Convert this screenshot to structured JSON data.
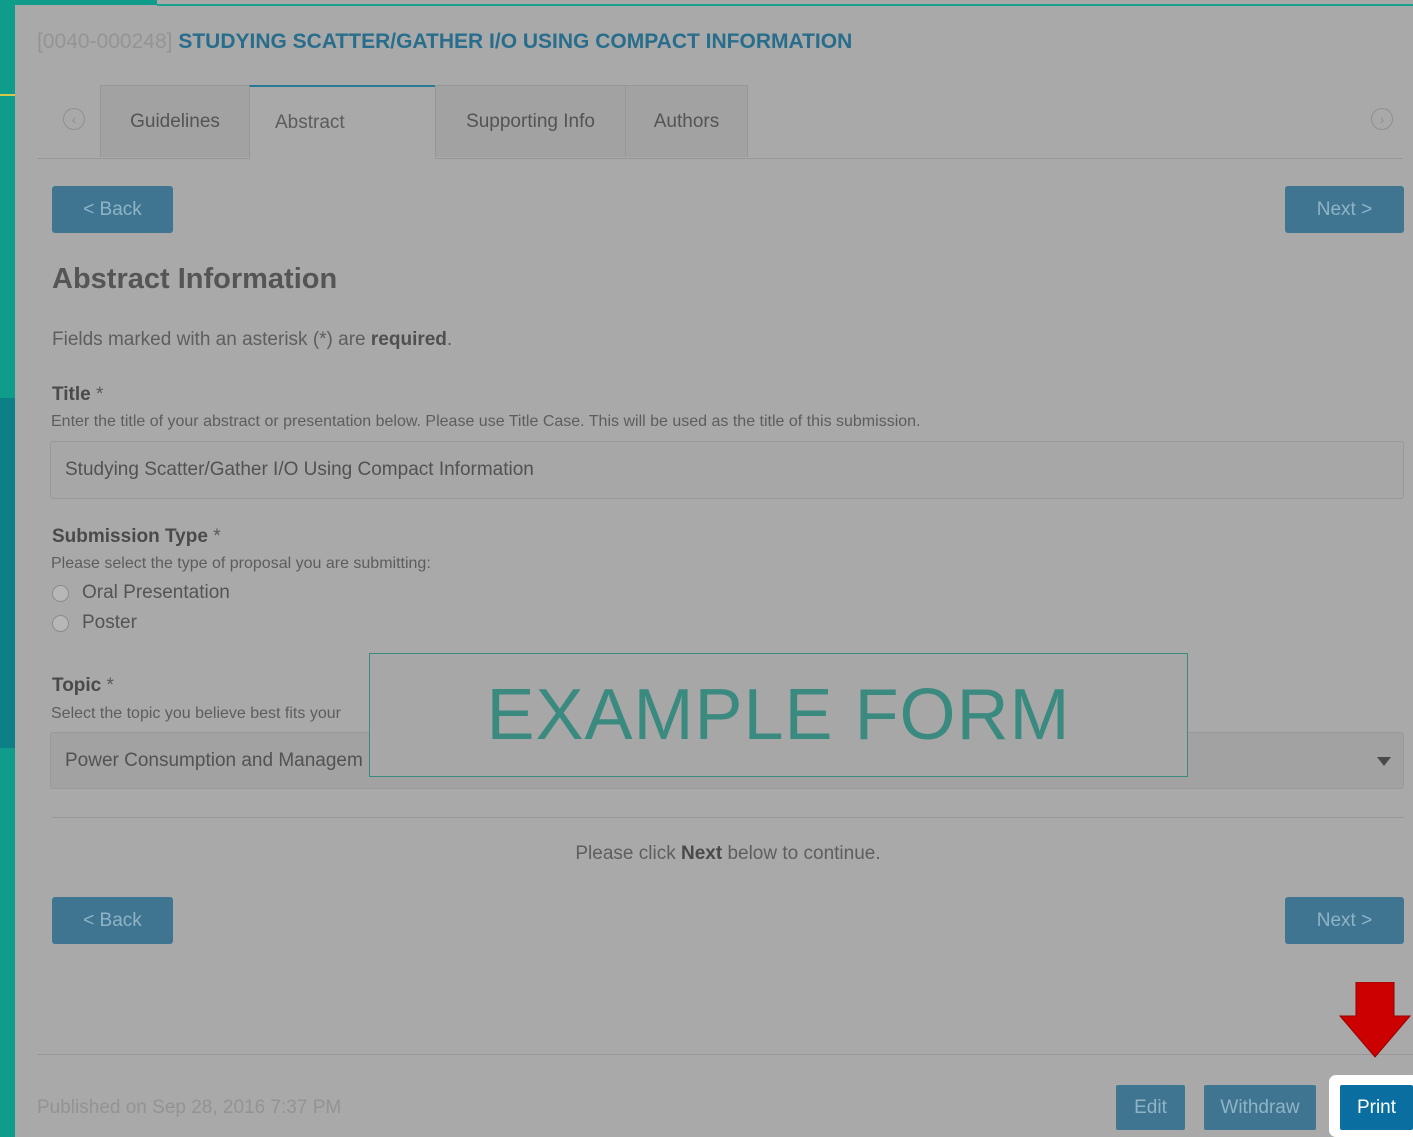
{
  "submission": {
    "code": "[0040-000248]",
    "title": "STUDYING SCATTER/GATHER I/O USING COMPACT INFORMATION"
  },
  "tabs": [
    {
      "label": "Guidelines"
    },
    {
      "label": "Abstract",
      "active": true
    },
    {
      "label": "Supporting Info"
    },
    {
      "label": "Authors"
    }
  ],
  "nav": {
    "back_label": "< Back",
    "next_label": "Next >"
  },
  "section": {
    "heading": "Abstract Information",
    "required_prefix": "Fields marked with an asterisk (*) are ",
    "required_word": "required",
    "required_suffix": "."
  },
  "fields": {
    "title": {
      "label": "Title",
      "asterisk": "*",
      "help": "Enter the title of your abstract or presentation below. Please use Title Case. This will be used as the title of this submission.",
      "value": "Studying Scatter/Gather I/O Using Compact Information"
    },
    "submission_type": {
      "label": "Submission Type",
      "asterisk": "*",
      "help": "Please select the type of proposal you are submitting:",
      "options": [
        "Oral Presentation",
        "Poster"
      ]
    },
    "topic": {
      "label": "Topic",
      "asterisk": "*",
      "help": "Select the topic you believe best fits your",
      "value": "Power Consumption and Managem"
    }
  },
  "continue_note": {
    "prefix": "Please click ",
    "bold": "Next",
    "suffix": " below to continue."
  },
  "overlay": {
    "text": "EXAMPLE FORM"
  },
  "footer": {
    "published": "Published on Sep 28, 2016 7:37 PM",
    "edit_label": "Edit",
    "withdraw_label": "Withdraw",
    "print_label": "Print"
  },
  "colors": {
    "accent": "#0a6fa0",
    "button": "#3f7591",
    "title": "#286e8c",
    "teal": "#0f9c8a",
    "arrow": "#cc0000"
  },
  "icons": {
    "tab_prev": "chevron-left-circle-icon",
    "tab_next": "chevron-right-circle-icon",
    "select_caret": "caret-down-icon",
    "pointer": "arrow-down-icon"
  }
}
